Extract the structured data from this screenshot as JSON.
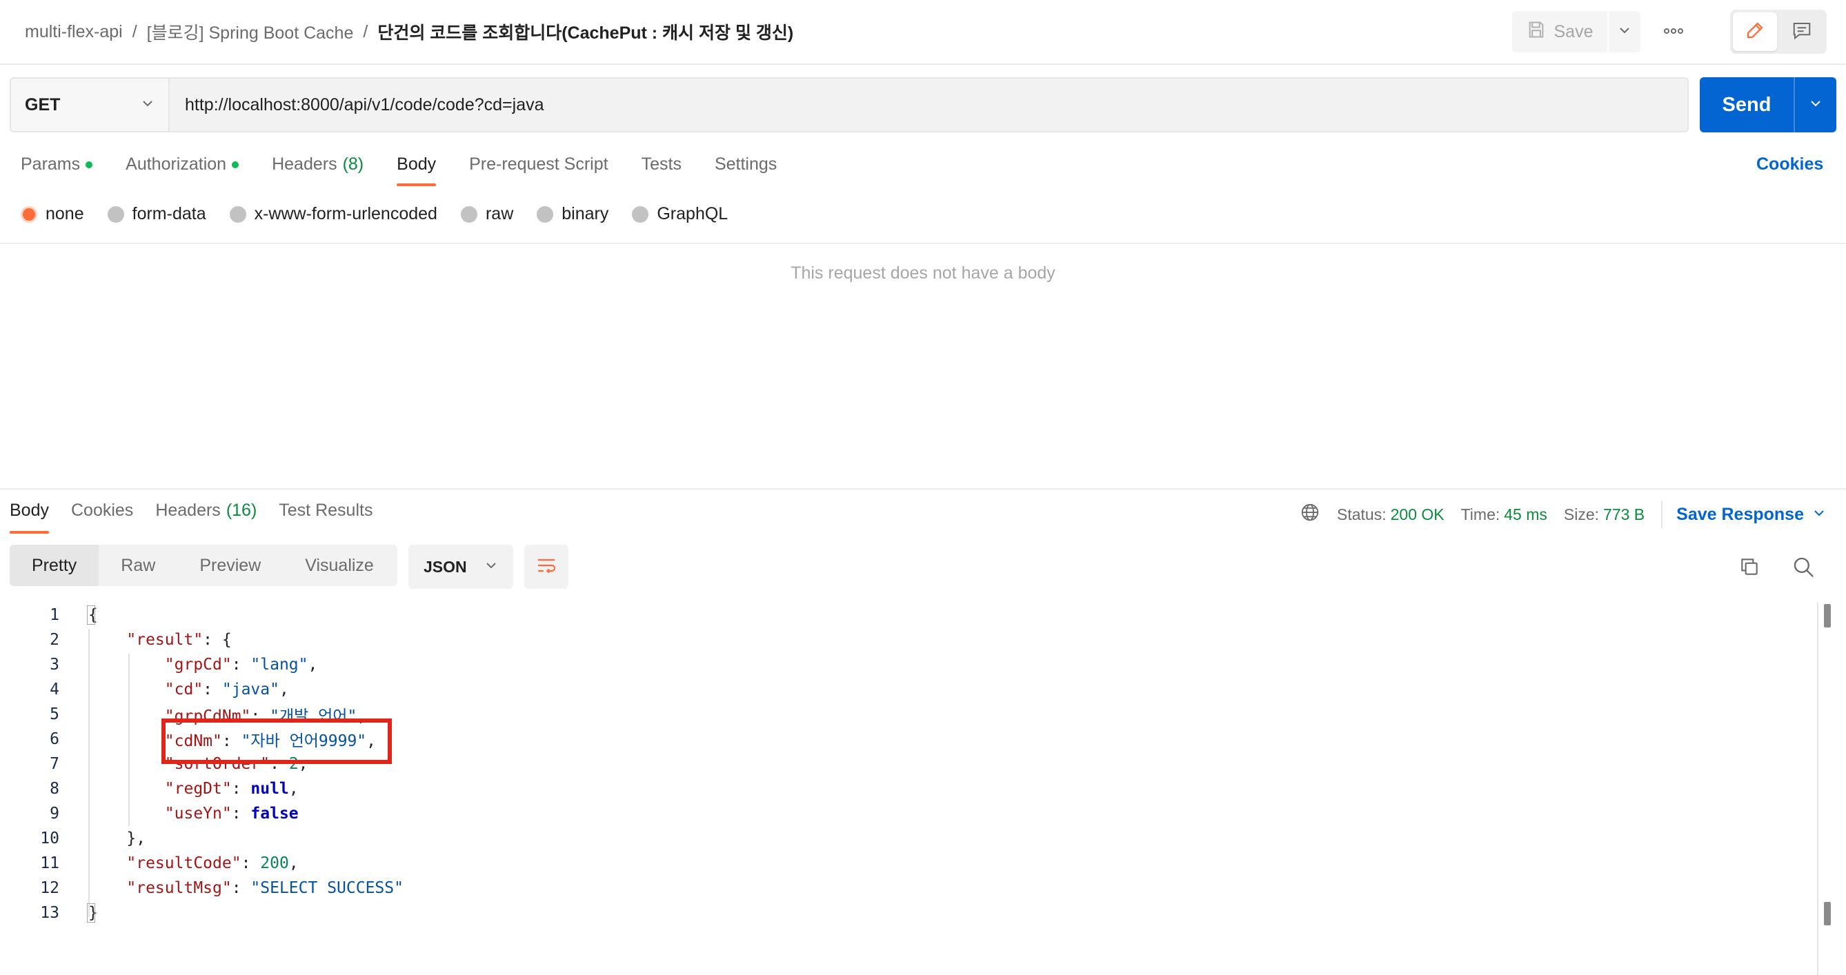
{
  "header": {
    "breadcrumb": [
      "multi-flex-api",
      "[블로깅] Spring Boot Cache",
      "단건의 코드를 조회합니다(CachePut : 캐시 저장 및 갱신)"
    ],
    "breadcrumb_sep": "/",
    "save_label": "Save"
  },
  "request": {
    "method": "GET",
    "url": "http://localhost:8000/api/v1/code/code?cd=java",
    "send_label": "Send",
    "tabs": [
      {
        "label": "Params",
        "dot": true
      },
      {
        "label": "Authorization",
        "dot": true
      },
      {
        "label": "Headers",
        "count": "(8)"
      },
      {
        "label": "Body",
        "active": true
      },
      {
        "label": "Pre-request Script"
      },
      {
        "label": "Tests"
      },
      {
        "label": "Settings"
      }
    ],
    "cookies_label": "Cookies",
    "body_types": [
      "none",
      "form-data",
      "x-www-form-urlencoded",
      "raw",
      "binary",
      "GraphQL"
    ],
    "selected_body_type": "none",
    "empty_body_text": "This request does not have a body"
  },
  "response": {
    "tabs": [
      {
        "label": "Body",
        "active": true
      },
      {
        "label": "Cookies"
      },
      {
        "label": "Headers",
        "count": "(16)"
      },
      {
        "label": "Test Results"
      }
    ],
    "status_label": "Status:",
    "status_value": "200 OK",
    "time_label": "Time:",
    "time_value": "45 ms",
    "size_label": "Size:",
    "size_value": "773 B",
    "save_response_label": "Save Response",
    "view_modes": [
      "Pretty",
      "Raw",
      "Preview",
      "Visualize"
    ],
    "format": "JSON",
    "code_lines": [
      "1",
      "2",
      "3",
      "4",
      "5",
      "6",
      "7",
      "8",
      "9",
      "10",
      "11",
      "12",
      "13"
    ],
    "json": {
      "grpCd_key": "\"grpCd\"",
      "grpCd_val": "\"lang\"",
      "cd_key": "\"cd\"",
      "cd_val": "\"java\"",
      "grpCdNm_key": "\"grpCdNm\"",
      "grpCdNm_val": "\"개발 언어\"",
      "cdNm_key": "\"cdNm\"",
      "cdNm_val": "\"자바 언어9999\"",
      "sortOrder_key": "\"sortOrder\"",
      "sortOrder_val": "2",
      "regDt_key": "\"regDt\"",
      "regDt_val": "null",
      "useYn_key": "\"useYn\"",
      "useYn_val": "false",
      "result_key": "\"result\"",
      "resultCode_key": "\"resultCode\"",
      "resultCode_val": "200",
      "resultMsg_key": "\"resultMsg\"",
      "resultMsg_val": "\"SELECT SUCCESS\""
    }
  },
  "colors": {
    "accent": "#ff6c37",
    "primary": "#0265d2",
    "success": "#0c8a3e",
    "annotation": "#e0261b"
  }
}
